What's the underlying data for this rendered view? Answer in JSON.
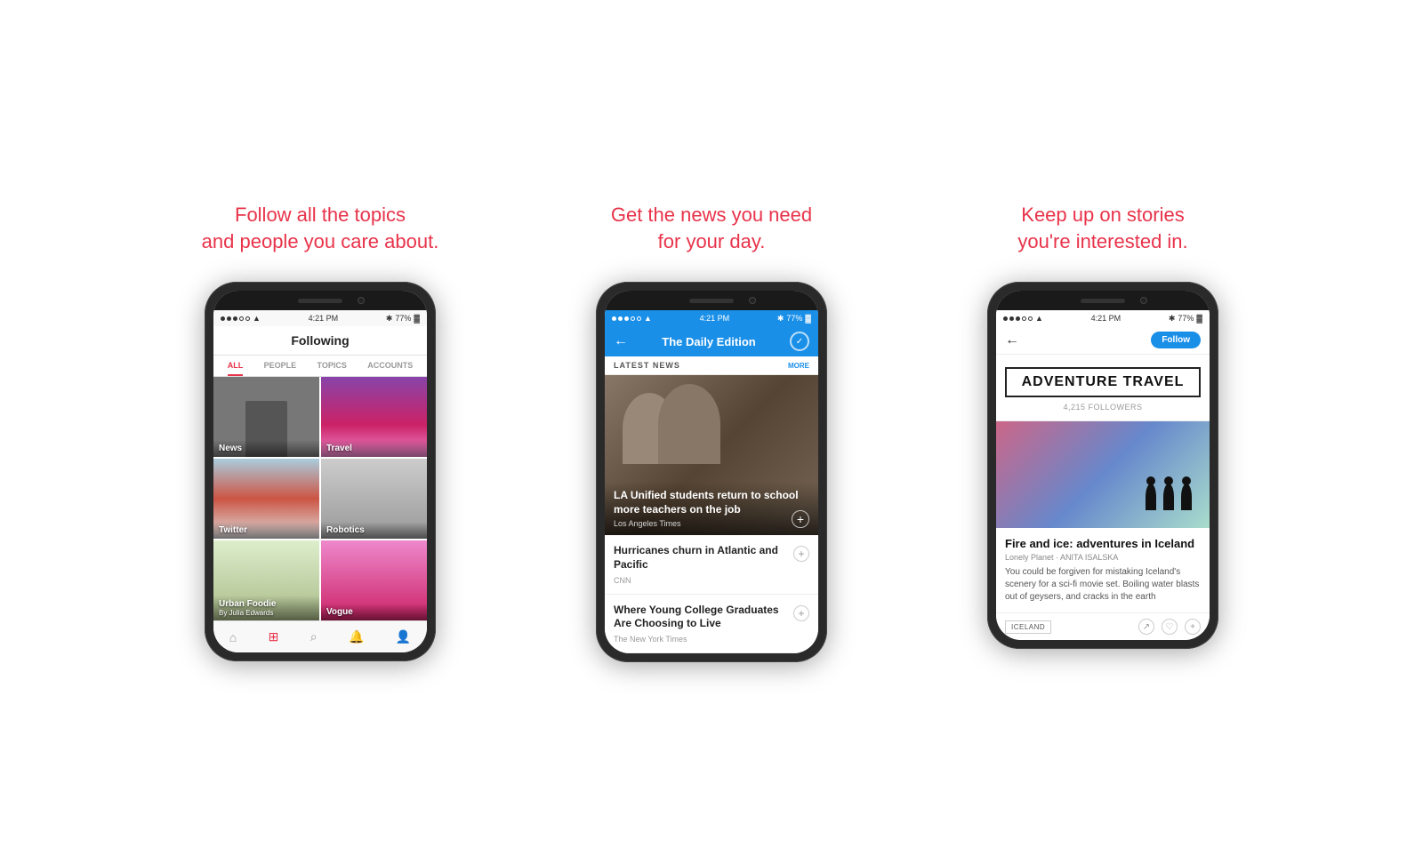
{
  "phone1": {
    "tagline": "Follow all the topics\nand people you care about.",
    "status": {
      "time": "4:21 PM",
      "battery": "77%",
      "signal": "●●●○○"
    },
    "header_title": "Following",
    "tabs": [
      "ALL",
      "PEOPLE",
      "TOPICS",
      "ACCOUNTS"
    ],
    "active_tab": "ALL",
    "grid": [
      {
        "label": "News",
        "sublabel": ""
      },
      {
        "label": "Travel",
        "sublabel": ""
      },
      {
        "label": "Twitter",
        "sublabel": ""
      },
      {
        "label": "Robotics",
        "sublabel": ""
      },
      {
        "label": "Urban Foodie",
        "sublabel": "By Julia Edwards"
      },
      {
        "label": "Vogue",
        "sublabel": ""
      }
    ]
  },
  "phone2": {
    "tagline": "Get the news you need\nfor your day.",
    "status": {
      "time": "4:21 PM",
      "battery": "77%"
    },
    "nav_back": "←",
    "nav_title": "The Daily Edition",
    "section_label": "LATEST NEWS",
    "section_more": "MORE",
    "hero": {
      "headline": "LA Unified students return to school more teachers on the job",
      "source": "Los Angeles Times"
    },
    "articles": [
      {
        "headline": "Hurricanes churn in Atlantic and Pacific",
        "source": "CNN"
      },
      {
        "headline": "Where Young College Graduates Are Choosing to Live",
        "source": "The New York Times"
      }
    ]
  },
  "phone3": {
    "tagline": "Keep up on stories\nyou're interested in.",
    "status": {
      "time": "4:21 PM",
      "battery": "77%"
    },
    "nav_back": "←",
    "follow_label": "Follow",
    "topic": {
      "title": "ADVENTURE TRAVEL",
      "followers": "4,215 FOLLOWERS"
    },
    "article": {
      "title": "Fire and ice: adventures in Iceland",
      "byline": "Lonely Planet · ANITA ISALSKA",
      "text": "You could be forgiven for mistaking Iceland's scenery for a sci-fi movie set. Boiling water blasts out of geysers, and cracks in the earth",
      "tag": "ICELAND"
    }
  }
}
